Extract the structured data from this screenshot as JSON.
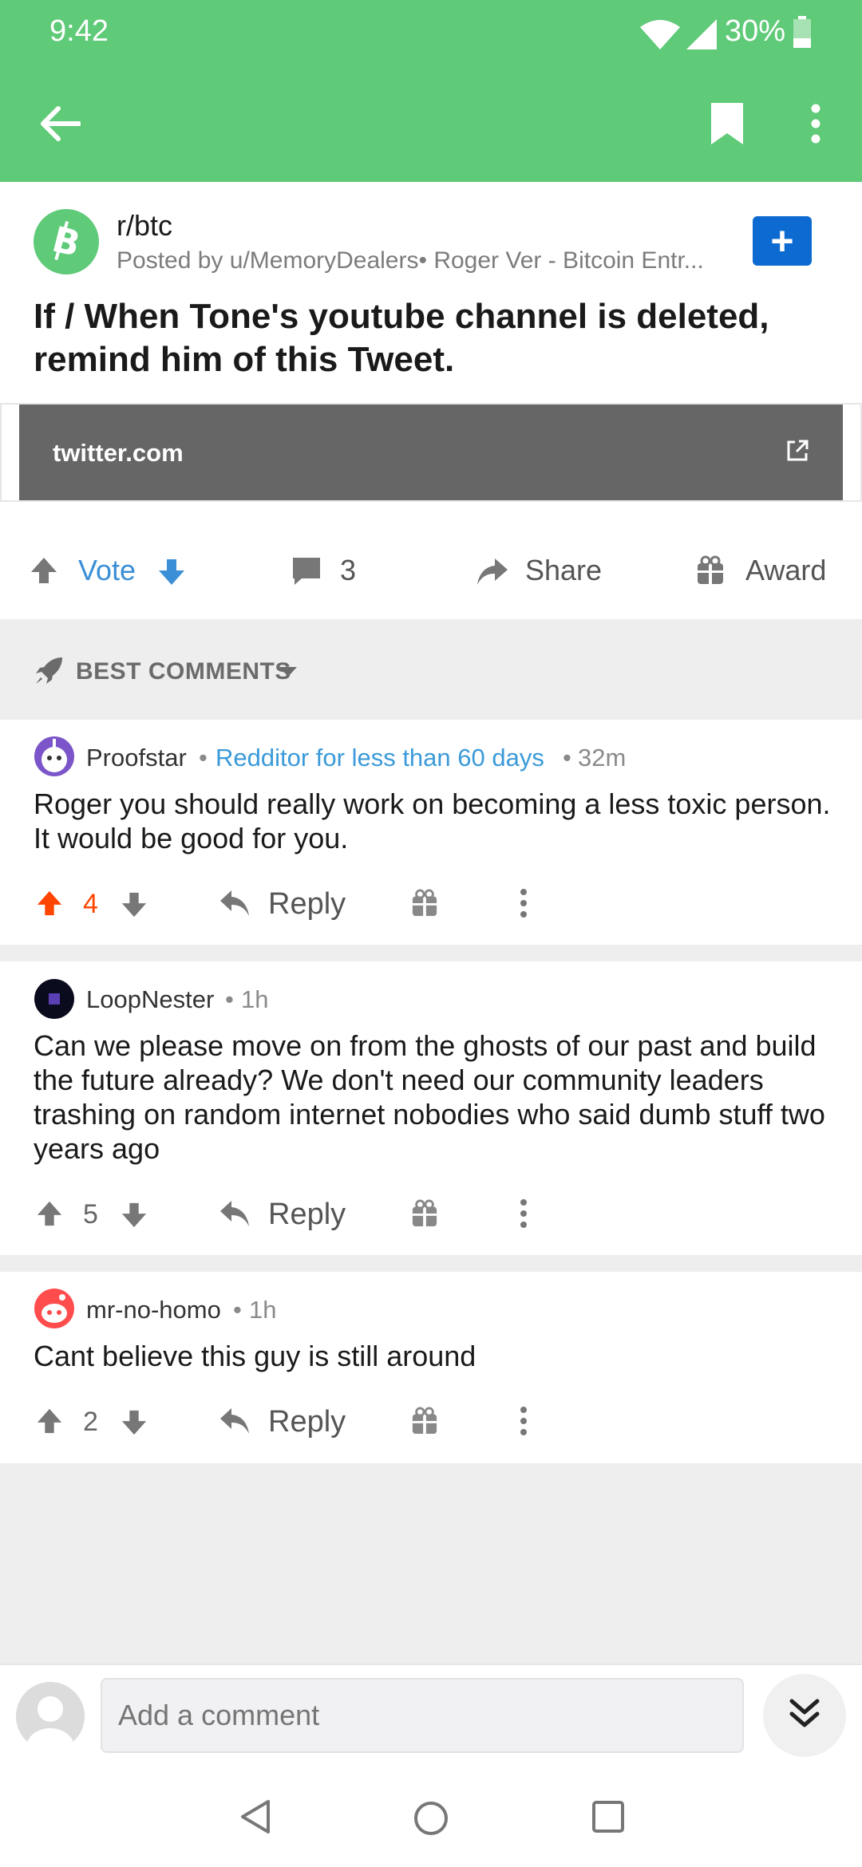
{
  "status_bar": {
    "time": "9:42",
    "battery": "30%"
  },
  "post": {
    "subreddit": "r/btc",
    "posted_by": "Posted by u/MemoryDealers• Roger Ver - Bitcoin Entr...",
    "join_label": "+",
    "title": "If / When Tone's youtube channel is deleted, remind him of this Tweet.",
    "link_domain": "twitter.com"
  },
  "actions": {
    "vote_label": "Vote",
    "comment_count": "3",
    "share_label": "Share",
    "award_label": "Award"
  },
  "sort": {
    "label": "BEST COMMENTS"
  },
  "comments": [
    {
      "author": "Proofstar",
      "flair": "Redditor for less than 60 days",
      "time": "32m",
      "body": "Roger you should really work on becoming a less toxic person. It would be good for you.",
      "score": "4",
      "upvoted": true,
      "reply_label": "Reply"
    },
    {
      "author": "LoopNester",
      "time": "1h",
      "body": "Can we please move on from the ghosts of our past and build the future already? We don't need our community leaders trashing on random internet nobodies who said dumb stuff two years ago",
      "score": "5",
      "reply_label": "Reply"
    },
    {
      "author": "mr-no-homo",
      "time": "1h",
      "body": "Cant believe this guy is still around",
      "score": "2",
      "reply_label": "Reply"
    }
  ],
  "comment_bar": {
    "placeholder": "Add a comment"
  },
  "colors": {
    "toolbar": "#5fca78",
    "upvote_active": "#ff4500",
    "link_blue": "#3b8fd6"
  }
}
